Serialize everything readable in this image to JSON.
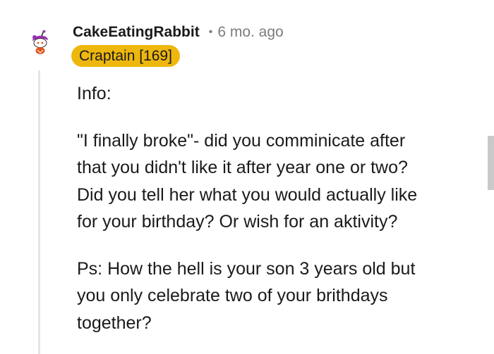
{
  "comment": {
    "author": "CakeEatingRabbit",
    "separator": "•",
    "age": "6 mo. ago",
    "flair": "Craptain [169]",
    "paragraphs": [
      "Info:",
      "\"I finally broke\"- did you comminicate after\nthat you didn't like it after year one or two?\nDid you tell her what you would actually like\nfor your birthday? Or wish for an aktivity?",
      "Ps: How the hell is your son 3 years old but\nyou only celebrate two of your brithdays\ntogether?"
    ]
  },
  "avatar": {
    "icon": "snoo-avatar-icon",
    "hair_color": "#9b2fb3",
    "shirt_color": "#e0531c"
  },
  "colors": {
    "flair_background": "#eeb70e",
    "meta_text": "#7c7c7c",
    "thread_line": "#e3e5e8"
  }
}
